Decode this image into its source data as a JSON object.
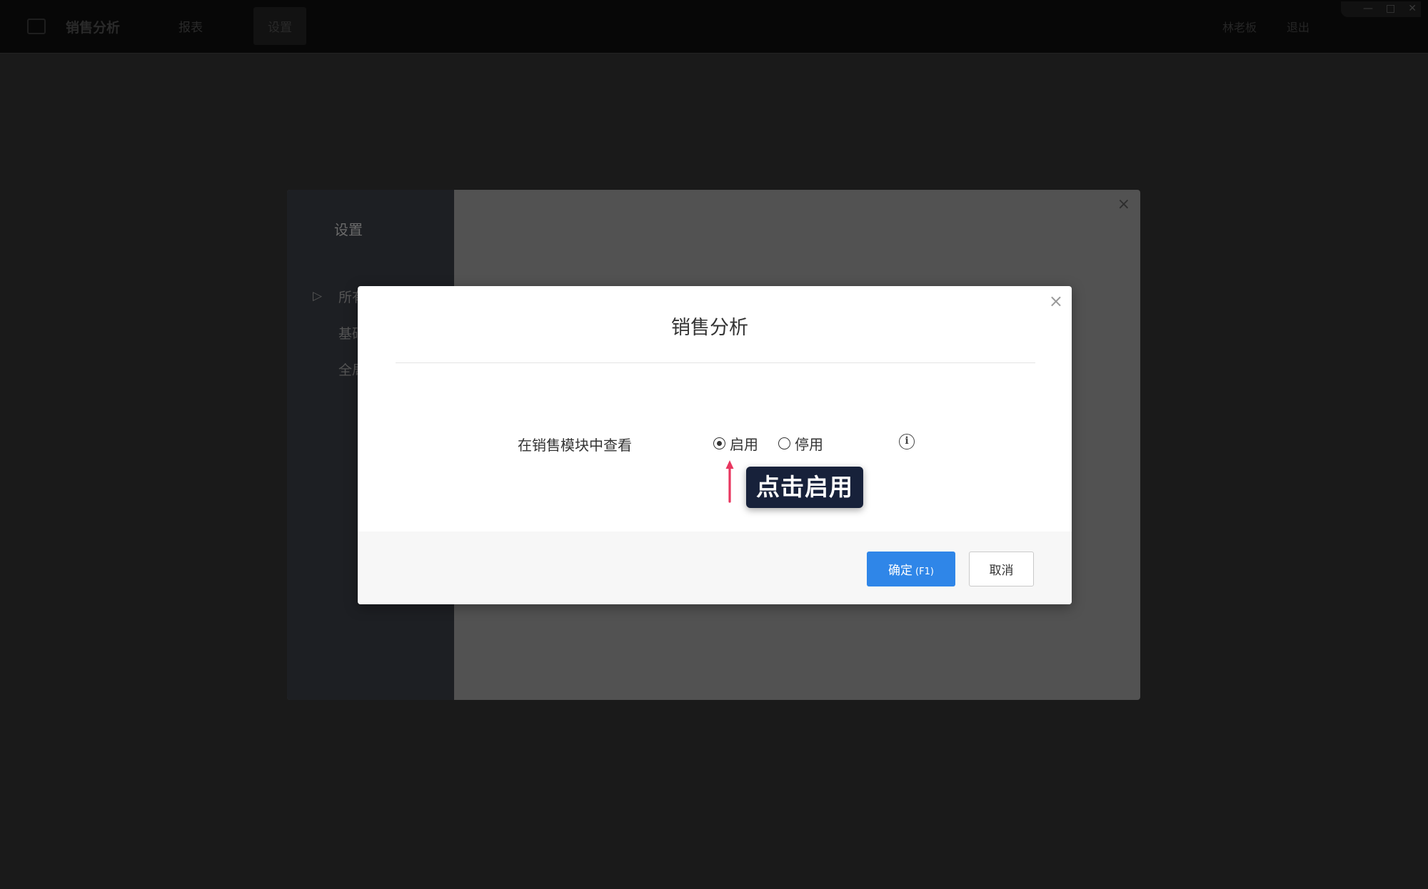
{
  "topbar": {
    "app_title": "销售分析",
    "nav": [
      {
        "label": "报表"
      },
      {
        "label": "设置"
      }
    ],
    "right": [
      {
        "label": "林老板"
      },
      {
        "label": "退出"
      }
    ],
    "window_controls": [
      "—",
      "□",
      "✕"
    ]
  },
  "settings": {
    "title": "设置",
    "sidebar_items": [
      {
        "label": "所有"
      },
      {
        "label": "基础"
      },
      {
        "label": "全局"
      }
    ],
    "close_glyph": "×"
  },
  "modal": {
    "title": "销售分析",
    "close_glyph": "×",
    "field_label": "在销售模块中查看",
    "options": [
      {
        "label": "启用",
        "checked": true
      },
      {
        "label": "停用",
        "checked": false
      }
    ],
    "info_glyph": "i",
    "hint": "点击启用",
    "confirm_label": "确定",
    "confirm_hotkey": "(F1)",
    "cancel_label": "取消"
  },
  "colors": {
    "primary": "#2f86e8",
    "hint_bg": "#17213a",
    "hint_arrow": "#e8365f"
  }
}
